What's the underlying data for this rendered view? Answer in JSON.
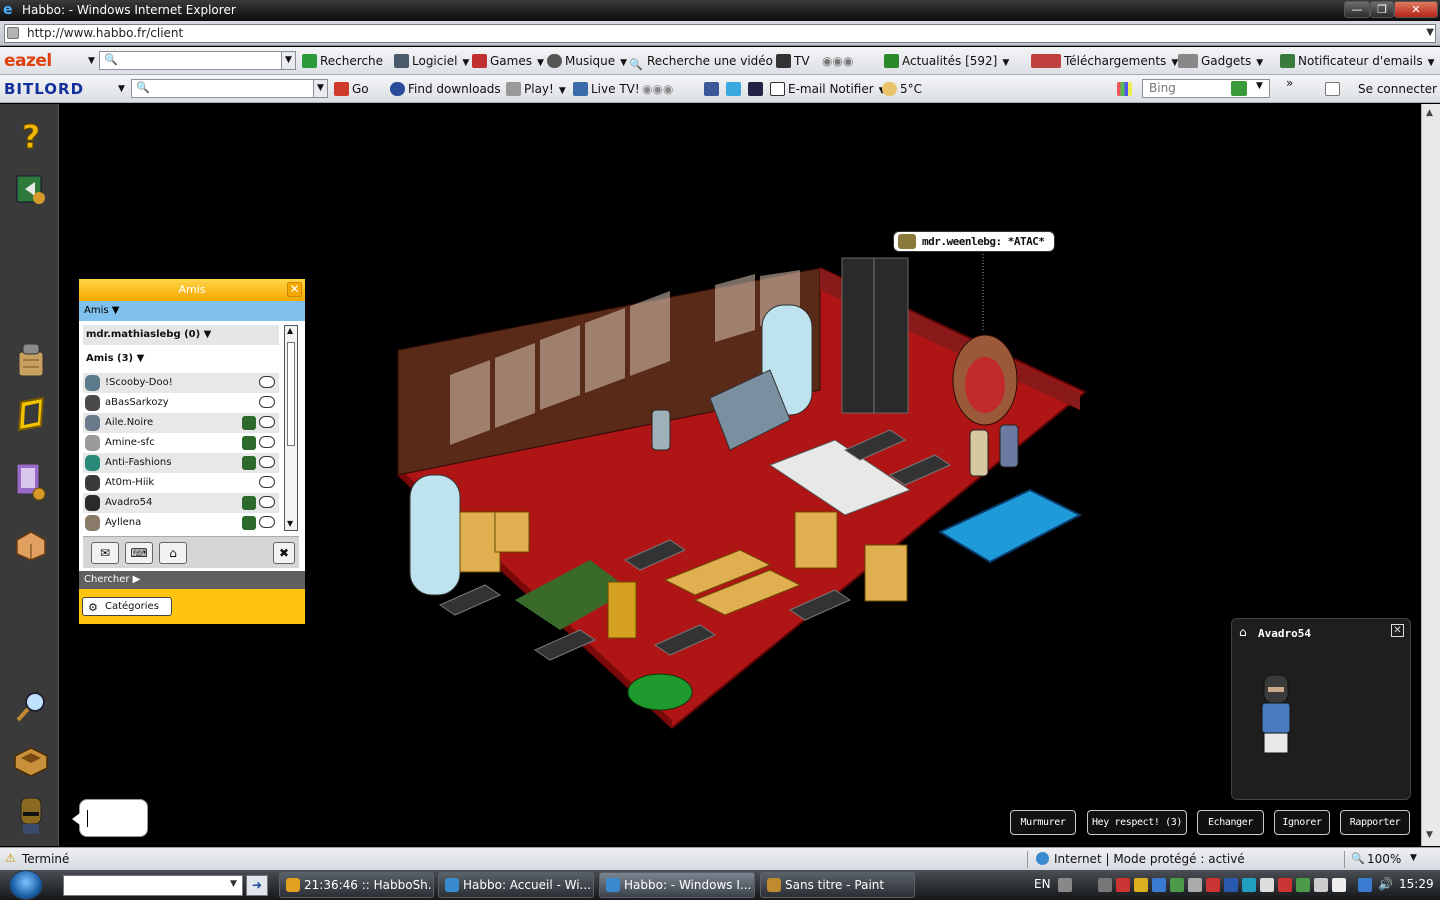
{
  "window": {
    "title": "Habbo: - Windows Internet Explorer",
    "minimize": "—",
    "restore": "❐",
    "close": "✕"
  },
  "address": {
    "url": "http://www.habbo.fr/client"
  },
  "toolbar1": {
    "logo": "eazel",
    "recherche": "Recherche",
    "logiciel": "Logiciel",
    "games": "Games",
    "musique": "Musique",
    "recherche_video": "Recherche une vidéo",
    "tv": "TV",
    "actualites": "Actualités [592]",
    "telechargements": "Téléchargements",
    "gadgets": "Gadgets",
    "notificateur": "Notificateur d'emails"
  },
  "toolbar2": {
    "logo": "BITLORD",
    "go": "Go",
    "find_downloads": "Find downloads",
    "play": "Play!",
    "live_tv": "Live TV!",
    "email_notifier": "E-mail Notifier",
    "weather": "5°C",
    "bing_placeholder": "Bing",
    "se_connecter": "Se connecter"
  },
  "friends": {
    "title": "Amis",
    "tab": "Amis",
    "group1": "mdr.mathiaslebg (0)",
    "group2": "Amis (3)",
    "list": [
      {
        "name": "!Scooby-Doo!",
        "follow": false
      },
      {
        "name": "aBasSarkozy",
        "follow": false
      },
      {
        "name": "Aile.Noire",
        "follow": true
      },
      {
        "name": "Amine-sfc",
        "follow": true
      },
      {
        "name": "Anti-Fashions",
        "follow": true
      },
      {
        "name": "At0m-Hiik",
        "follow": false
      },
      {
        "name": "Avadro54",
        "follow": true
      },
      {
        "name": "Ayllena",
        "follow": true
      }
    ],
    "search_label": "Chercher",
    "categories": "Catégories"
  },
  "room": {
    "speech_user": "mdr.weenlebg:",
    "speech_text": "*ATAC*"
  },
  "profile": {
    "name": "Avadro54"
  },
  "actions": {
    "murmurer": "Murmurer",
    "respect": "Hey respect! (3)",
    "echanger": "Echanger",
    "ignorer": "Ignorer",
    "rapporter": "Rapporter"
  },
  "status": {
    "text": "Terminé",
    "zone": "Internet | Mode protégé : activé",
    "zoom": "100%"
  },
  "taskbar": {
    "items": [
      {
        "label": "21:36:46 :: HabboSh...",
        "active": false
      },
      {
        "label": "Habbo: Accueil - Wi...",
        "active": false
      },
      {
        "label": "Habbo: - Windows I...",
        "active": true
      },
      {
        "label": "Sans titre - Paint",
        "active": false
      }
    ],
    "lang": "EN",
    "clock": "15:29"
  },
  "colors": {
    "habbo_yellow": "#ffc40d",
    "habbo_blue": "#7fc1ec",
    "room_floor": "#b01515"
  }
}
